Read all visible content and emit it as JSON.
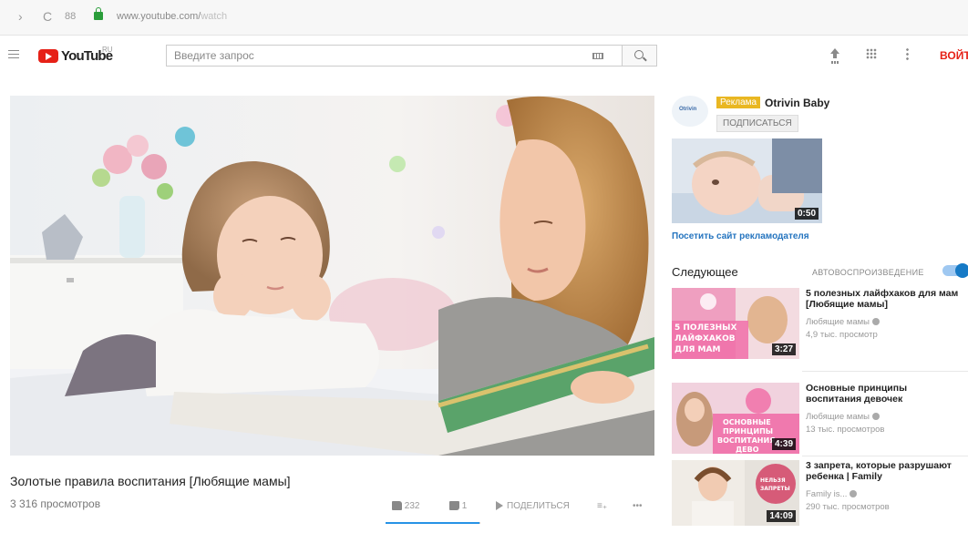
{
  "browser": {
    "url_host": "www.youtube.com/",
    "url_path": "watch"
  },
  "header": {
    "logo_text": "YouTube",
    "region": "RU",
    "search_placeholder": "Введите запрос",
    "signin_label": "ВОЙТИ"
  },
  "video": {
    "title": "Золотые правила воспитания [Любящие мамы]",
    "views": "3 316 просмотров",
    "likes": "232",
    "dislikes": "1",
    "share_label": "ПОДЕЛИТЬСЯ",
    "like_ratio": 0.99
  },
  "ad": {
    "badge": "Реклама",
    "advertiser": "Otrivin Baby",
    "logo_text": "Otrivin",
    "subscribe_label": "ПОДПИСАТЬСЯ",
    "duration": "0:50",
    "visit_link": "Посетить сайт рекламодателя"
  },
  "up_next": {
    "label": "Следующее",
    "autoplay_label": "АВТОВОСПРОИЗВЕДЕНИЕ",
    "autoplay_on": true
  },
  "recommendations": [
    {
      "title": "5 полезных лайфхаков для мам [Любящие мамы]",
      "channel": "Любящие мамы",
      "views": "4,9 тыс. просмотр",
      "duration": "3:27",
      "thumb_text": [
        "5 ПОЛЕЗНЫХ",
        "ЛАЙФХАКОВ",
        "ДЛЯ МАМ"
      ]
    },
    {
      "title": "Основные принципы воспитания девочек",
      "channel": "Любящие мамы",
      "views": "13 тыс. просмотров",
      "duration": "4:39",
      "thumb_text": [
        "ОСНОВНЫЕ",
        "ПРИНЦИПЫ",
        "ВОСПИТАНИЯ",
        "ДЕВО"
      ]
    },
    {
      "title": "3 запрета, которые разрушают ребенка | Family",
      "channel": "Family is...",
      "views": "290 тыс. просмотров",
      "duration": "14:09",
      "thumb_text": [
        "НЕЛЬЗЯ",
        "ЗАПРЕТЫ"
      ]
    }
  ],
  "colors": {
    "brand_red": "#e62117",
    "link_blue": "#2474bf",
    "ad_badge": "#e9b722",
    "toggle_blue": "#167ac6"
  }
}
